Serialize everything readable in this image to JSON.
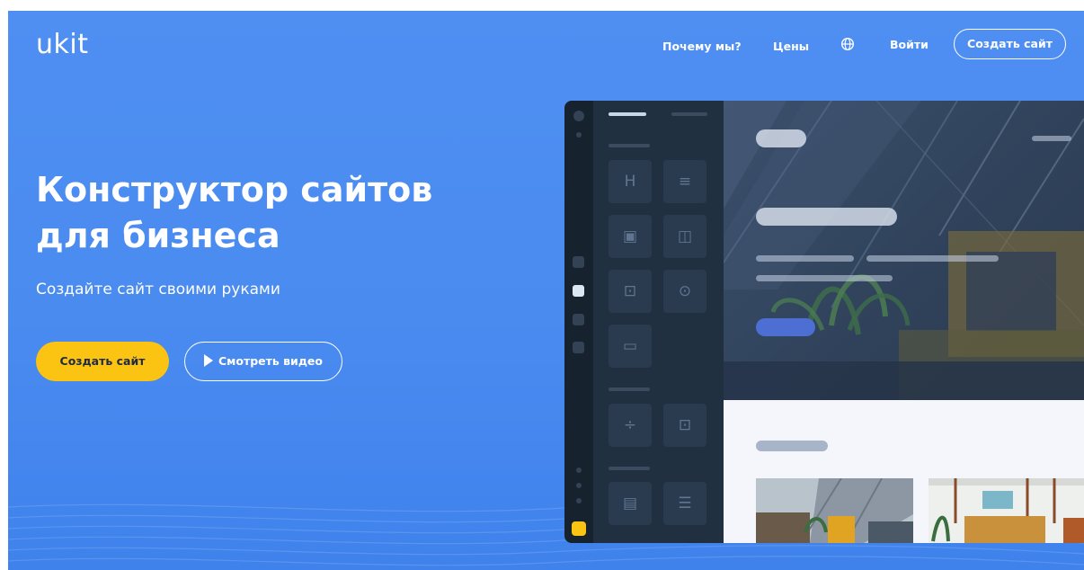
{
  "header": {
    "logo": "ukit",
    "nav_why": "Почему мы?",
    "nav_prices": "Цены",
    "language_icon": "globe-icon",
    "nav_login": "Войти",
    "create_button": "Создать сайт"
  },
  "hero": {
    "title_line1": "Конструктор сайтов",
    "title_line2": "для бизнеса",
    "subtitle": "Создайте сайт своими руками",
    "primary_button": "Создать сайт",
    "video_button": "Смотреть видео",
    "play_icon": "play-icon"
  },
  "editor_mockup": {
    "tiles": [
      {
        "name": "heading-block-icon",
        "glyph": "H"
      },
      {
        "name": "text-block-icon",
        "glyph": "≡"
      },
      {
        "name": "image-block-icon",
        "glyph": "▣"
      },
      {
        "name": "gallery-block-icon",
        "glyph": "◫"
      },
      {
        "name": "slider-block-icon",
        "glyph": "⊡"
      },
      {
        "name": "video-block-icon",
        "glyph": "⊙"
      },
      {
        "name": "button-block-icon",
        "glyph": "▭"
      },
      {
        "name": "divider-block-icon",
        "glyph": "÷"
      },
      {
        "name": "spacer-block-icon",
        "glyph": "⊡"
      },
      {
        "name": "form-block-icon",
        "glyph": "▤"
      },
      {
        "name": "list-block-icon",
        "glyph": "☰"
      }
    ]
  },
  "colors": {
    "background": "#4a8bf0",
    "accent_yellow": "#fbc312",
    "editor_dark": "#17222f",
    "editor_panel": "#213041"
  }
}
